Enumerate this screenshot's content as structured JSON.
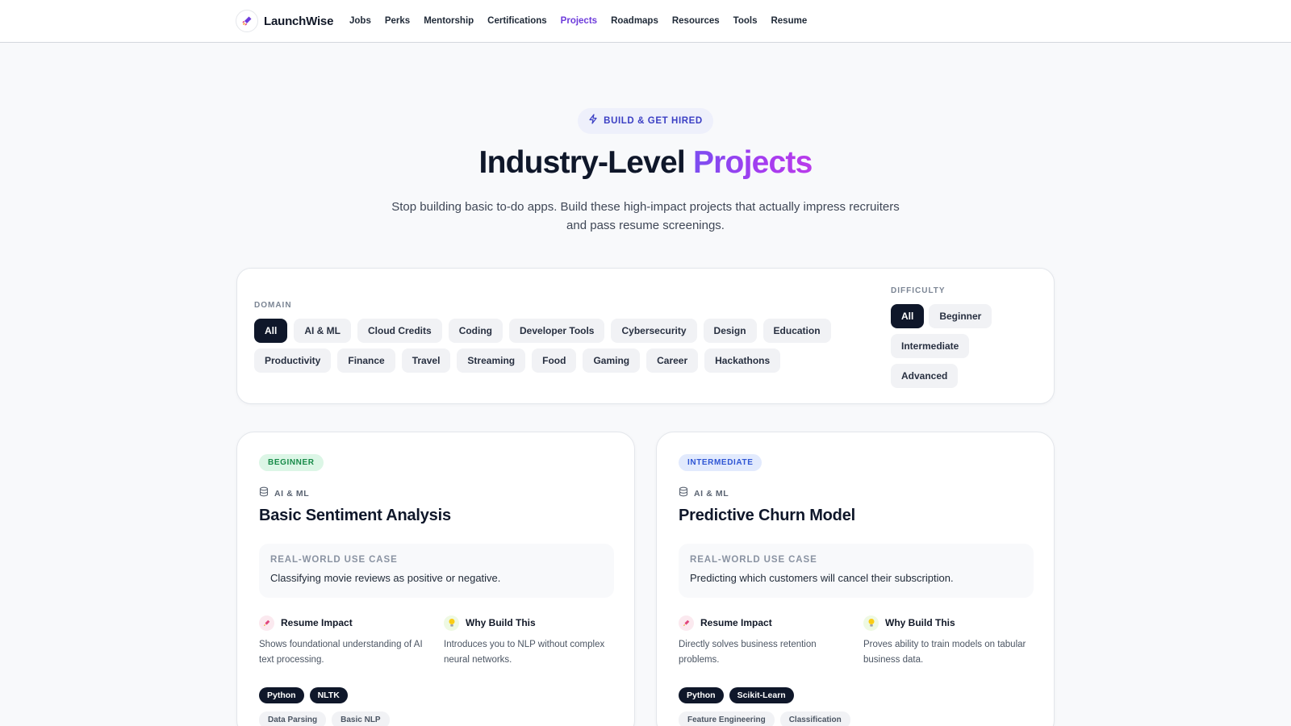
{
  "brand": {
    "name": "LaunchWise",
    "logo_icon": "rocket-icon"
  },
  "nav": {
    "links": [
      "Jobs",
      "Perks",
      "Mentorship",
      "Certifications",
      "Projects",
      "Roadmaps",
      "Resources",
      "Tools",
      "Resume"
    ],
    "active": "Projects",
    "active_color": "#6d3bdb"
  },
  "hero": {
    "eyebrow": "BUILD & GET HIRED",
    "eyebrow_icon": "lightning-icon",
    "title_part1": "Industry-Level",
    "title_part2": "Projects",
    "subtitle": "Stop building basic to-do apps. Build these high-impact projects that actually impress recruiters and pass resume screenings."
  },
  "filters": {
    "domain_label": "DOMAIN",
    "domains": [
      "All",
      "AI & ML",
      "Cloud Credits",
      "Coding",
      "Developer Tools",
      "Cybersecurity",
      "Design",
      "Education",
      "Productivity",
      "Finance",
      "Travel",
      "Streaming",
      "Food",
      "Gaming",
      "Career",
      "Hackathons"
    ],
    "domain_selected": "All",
    "difficulty_label": "DIFFICULTY",
    "difficulties": [
      "All",
      "Beginner",
      "Intermediate",
      "Advanced"
    ],
    "difficulty_selected": "All"
  },
  "projects": [
    {
      "level": "BEGINNER",
      "domain": "AI & ML",
      "domain_icon": "database-icon",
      "title": "Basic Sentiment Analysis",
      "usecase_label": "REAL-WORLD USE CASE",
      "usecase": "Classifying movie reviews as positive or negative.",
      "impact_title": "Resume Impact",
      "impact_icon": "rocket-icon",
      "impact": "Shows foundational understanding of AI text processing.",
      "why_title": "Why Build This",
      "why_icon": "lightbulb-icon",
      "why": "Introduces you to NLP without complex neural networks.",
      "tech": [
        "Python",
        "NLTK"
      ],
      "skills": [
        "Data Parsing",
        "Basic NLP"
      ]
    },
    {
      "level": "INTERMEDIATE",
      "domain": "AI & ML",
      "domain_icon": "database-icon",
      "title": "Predictive Churn Model",
      "usecase_label": "REAL-WORLD USE CASE",
      "usecase": "Predicting which customers will cancel their subscription.",
      "impact_title": "Resume Impact",
      "impact_icon": "rocket-icon",
      "impact": "Directly solves business retention problems.",
      "why_title": "Why Build This",
      "why_icon": "lightbulb-icon",
      "why": "Proves ability to train models on tabular business data.",
      "tech": [
        "Python",
        "Scikit-Learn"
      ],
      "skills": [
        "Feature Engineering",
        "Classification"
      ]
    }
  ]
}
